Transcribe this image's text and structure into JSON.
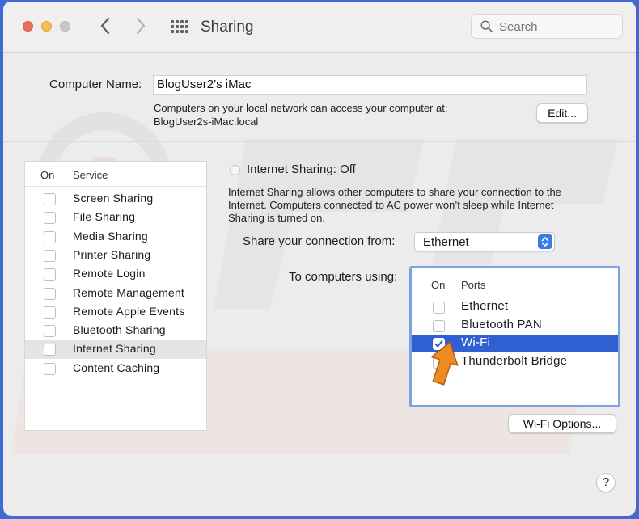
{
  "window": {
    "title": "Sharing",
    "nav_back_icon": "chevron-left-icon",
    "nav_forward_icon": "chevron-right-icon",
    "grid_icon": "show-all-grid-icon"
  },
  "search": {
    "placeholder": "Search"
  },
  "computer_name": {
    "label": "Computer Name:",
    "value": "BlogUser2’s iMac",
    "note_line1": "Computers on your local network can access your computer at:",
    "note_line2": "BlogUser2s-iMac.local",
    "edit_label": "Edit..."
  },
  "services": {
    "header_on": "On",
    "header_service": "Service",
    "selected_index": 8,
    "items": [
      {
        "label": "Screen Sharing",
        "checked": false
      },
      {
        "label": "File Sharing",
        "checked": false
      },
      {
        "label": "Media Sharing",
        "checked": false
      },
      {
        "label": "Printer Sharing",
        "checked": false
      },
      {
        "label": "Remote Login",
        "checked": false
      },
      {
        "label": "Remote Management",
        "checked": false
      },
      {
        "label": "Remote Apple Events",
        "checked": false
      },
      {
        "label": "Bluetooth Sharing",
        "checked": false
      },
      {
        "label": "Internet Sharing",
        "checked": false
      },
      {
        "label": "Content Caching",
        "checked": false
      }
    ]
  },
  "internet_sharing": {
    "status": "Internet Sharing: Off",
    "desc_line1": "Internet Sharing allows other computers to share your connection to the",
    "desc_line2": "Internet. Computers connected to AC power won’t sleep while Internet",
    "desc_line3": "Sharing is turned on.",
    "share_from_label": "Share your connection from:",
    "share_from_value": "Ethernet",
    "to_computers_label": "To computers using:",
    "ports_header_on": "On",
    "ports_header_ports": "Ports",
    "ports": [
      {
        "label": "Ethernet",
        "checked": false,
        "selected": false
      },
      {
        "label": "Bluetooth PAN",
        "checked": false,
        "selected": false
      },
      {
        "label": "Wi-Fi",
        "checked": true,
        "selected": true
      },
      {
        "label": "Thunderbolt Bridge",
        "checked": false,
        "selected": false
      }
    ],
    "wifi_options_label": "Wi-Fi Options..."
  },
  "help": {
    "label": "?"
  },
  "annotation": {
    "arrow_icon": "orange-pointer-arrow-icon",
    "arrow_color": "#f08a24"
  },
  "colors": {
    "accent": "#2f5fd0",
    "focus_ring": "#7ba2e6",
    "desktop": "#3f6ad3",
    "close": "#ed6a5e",
    "minimize": "#f5bf4f"
  }
}
